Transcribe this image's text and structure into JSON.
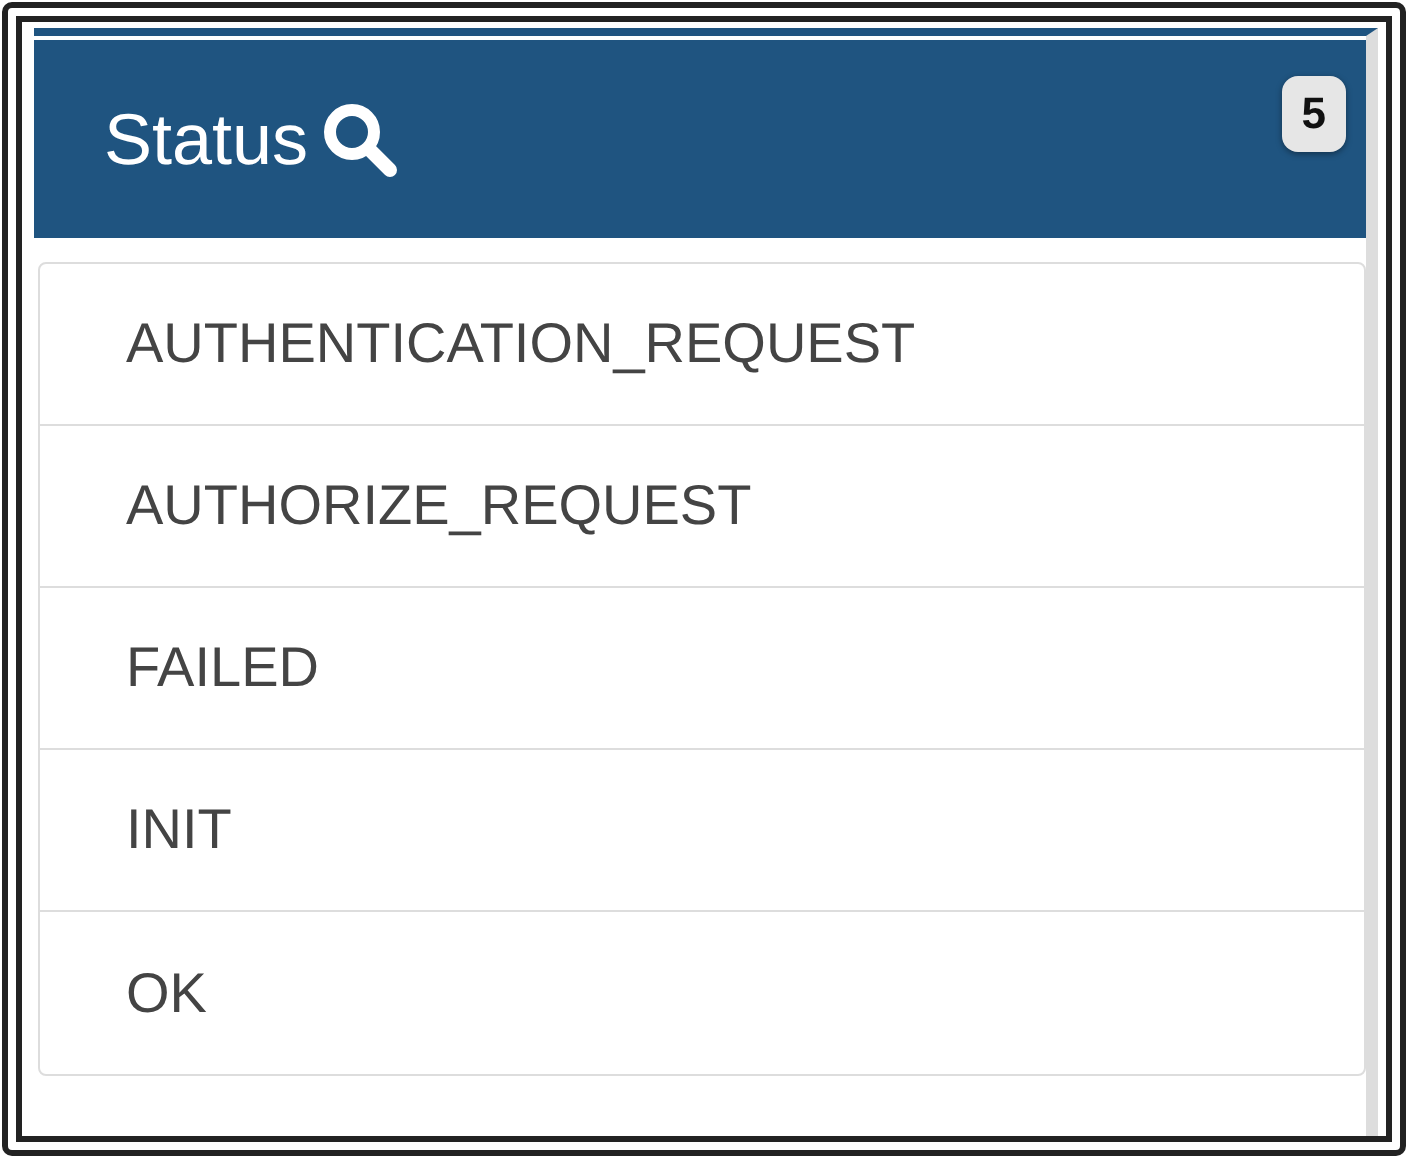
{
  "panel": {
    "title": "Status",
    "count": "5"
  },
  "items": [
    {
      "label": "AUTHENTICATION_REQUEST"
    },
    {
      "label": "AUTHORIZE_REQUEST"
    },
    {
      "label": "FAILED"
    },
    {
      "label": "INIT"
    },
    {
      "label": "OK"
    }
  ]
}
